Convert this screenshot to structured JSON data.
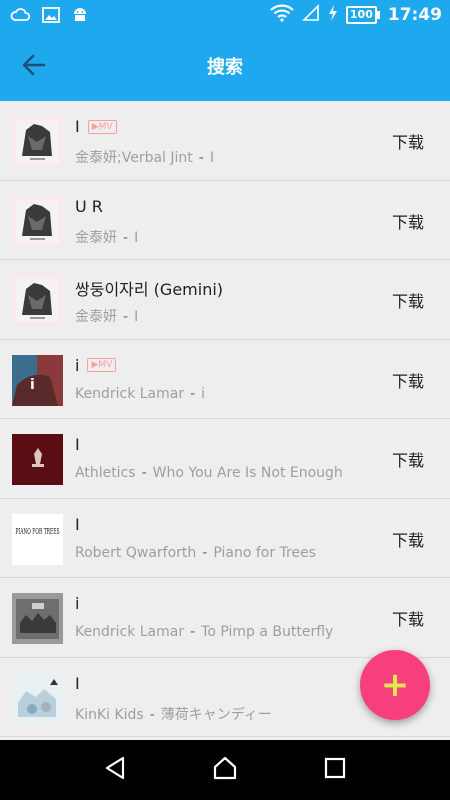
{
  "status_bar": {
    "time": "17:49",
    "battery": "100",
    "icons": [
      "cloud-icon",
      "image-icon",
      "android-icon",
      "wifi-icon",
      "signal-icon",
      "charging-icon"
    ]
  },
  "app_bar": {
    "title": "搜索",
    "back_icon": "arrow-left-icon"
  },
  "songs": [
    {
      "title": "I",
      "mv": true,
      "artist": "金泰妍;Verbal Jint",
      "album": "I",
      "download": "下载"
    },
    {
      "title": "U R",
      "mv": false,
      "artist": "金泰妍",
      "album": "I",
      "download": "下载"
    },
    {
      "title": "쌍둥이자리 (Gemini)",
      "mv": false,
      "artist": "金泰妍",
      "album": "I",
      "download": "下载"
    },
    {
      "title": "i",
      "mv": true,
      "artist": "Kendrick Lamar",
      "album": "i",
      "download": "下载"
    },
    {
      "title": "I",
      "mv": false,
      "artist": "Athletics",
      "album": "Who You Are Is Not Enough",
      "download": "下载"
    },
    {
      "title": "I",
      "mv": false,
      "artist": "Robert Qwarforth",
      "album": "Piano for Trees",
      "download": "下载"
    },
    {
      "title": "i",
      "mv": false,
      "artist": "Kendrick Lamar",
      "album": "To Pimp a Butterfly",
      "download": "下载"
    },
    {
      "title": "I",
      "mv": false,
      "artist": "KinKi Kids",
      "album": "薄荷キャンディー",
      "download": "下载"
    }
  ],
  "mv_label": "▶MV",
  "separator": "-",
  "covers": {
    "piano_text": "PIANO FOR TREES"
  },
  "fab": {
    "label": "+",
    "icon": "plus-icon"
  },
  "colors": {
    "primary": "#1EA8EE",
    "fab": "#F73F7D",
    "fab_plus": "#E2E84A",
    "list_bg": "#EEEEEE",
    "mv_tag": "#F8A0A0"
  },
  "nav": [
    "back-triangle-icon",
    "home-icon",
    "recents-icon"
  ]
}
